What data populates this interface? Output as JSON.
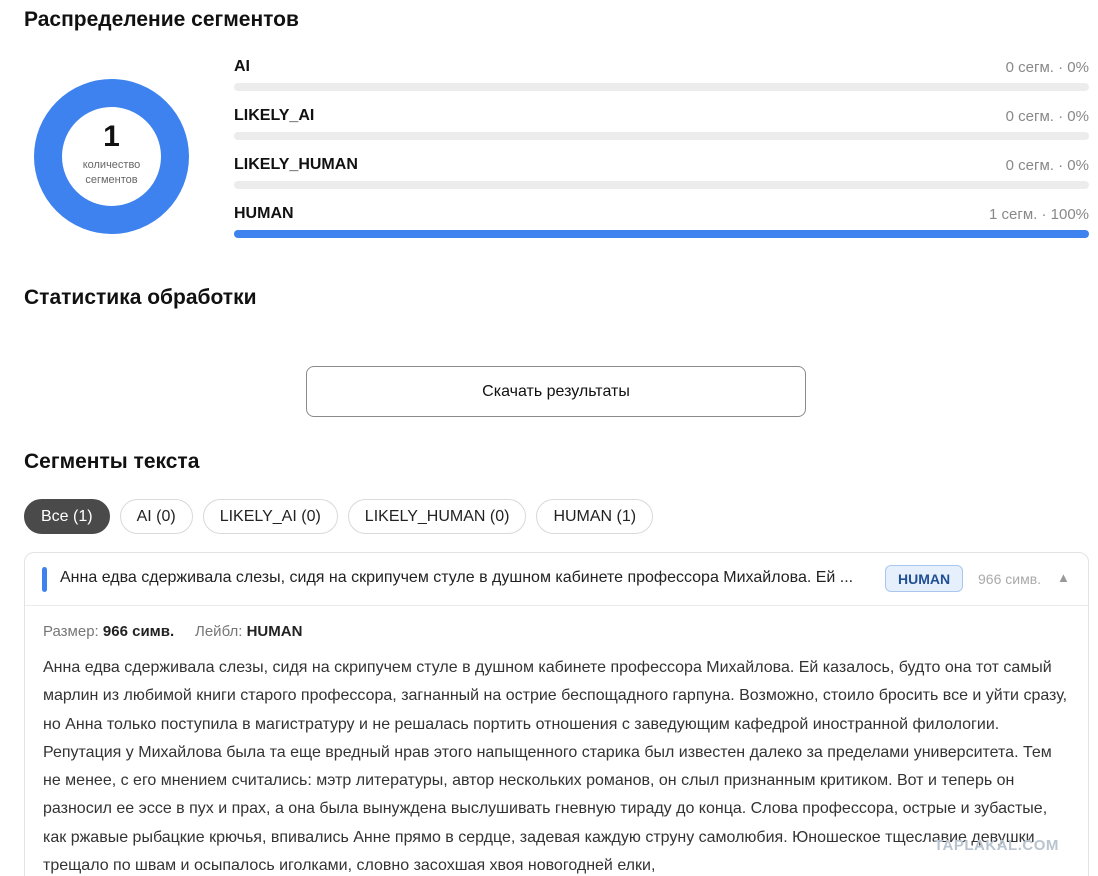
{
  "distribution": {
    "title": "Распределение сегментов",
    "donut": {
      "count": "1",
      "caption": "количество сегментов",
      "color": "#3d82ef"
    },
    "items": [
      {
        "label": "AI",
        "value_text": "0 сегм. · 0%",
        "fraction": 0.0
      },
      {
        "label": "LIKELY_AI",
        "value_text": "0 сегм. · 0%",
        "fraction": 0.0
      },
      {
        "label": "LIKELY_HUMAN",
        "value_text": "0 сегм. · 0%",
        "fraction": 0.0
      },
      {
        "label": "HUMAN",
        "value_text": "1 сегм. · 100%",
        "fraction": 1.0
      }
    ]
  },
  "stats": {
    "title": "Статистика обработки",
    "download_label": "Скачать результаты"
  },
  "segments": {
    "title": "Сегменты текста",
    "filters": [
      {
        "label": "Все (1)",
        "active": true
      },
      {
        "label": "AI (0)",
        "active": false
      },
      {
        "label": "LIKELY_AI (0)",
        "active": false
      },
      {
        "label": "LIKELY_HUMAN (0)",
        "active": false
      },
      {
        "label": "HUMAN (1)",
        "active": false
      }
    ],
    "card": {
      "preview": "Анна едва сдерживала слезы, сидя на скрипучем стуле в душном кабинете профессора Михайлова. Ей ...",
      "badge": "HUMAN",
      "size": "966 симв.",
      "toggle": "▲",
      "meta_size_label": "Размер:",
      "meta_size_value": "966 симв.",
      "meta_label_label": "Лейбл:",
      "meta_label_value": "HUMAN",
      "text": "Анна едва сдерживала слезы, сидя на скрипучем стуле в душном кабинете профессора Михайлова. Ей казалось, будто она тот самый марлин из любимой книги старого профессора, загнанный на острие беспощадного гарпуна. Возможно, стоило бросить все и уйти сразу, но Анна только поступила в магистратуру и не решалась портить отношения с заведующим кафедрой иностранной филологии. Репутация у Михайлова была та еще вредный нрав этого напыщенного старика был известен далеко за пределами университета. Тем не менее, с его мнением считались: мэтр литературы, автор нескольких романов, он слыл признанным критиком. Вот и теперь он разносил ее эссе в пух и прах, а она была вынуждена выслушивать гневную тираду до конца. Слова профессора, острые и зубастые, как ржавые рыбацкие крючья, впивались Анне прямо в сердце, задевая каждую струну самолюбия. Юношеское тщеславие девушки трещало по швам и осыпалось иголками, словно засохшая хвоя новогодней елки,"
    }
  },
  "watermark": "TAPLAKAL.COM"
}
